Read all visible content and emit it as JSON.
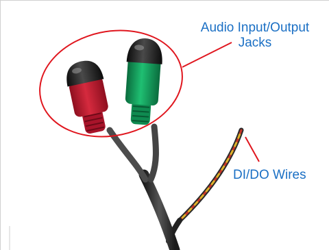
{
  "callouts": {
    "audio_line1": "Audio Input/Output",
    "audio_line2": "Jacks",
    "dido": "DI/DO Wires"
  },
  "colors": {
    "callout_text": "#1a6fc4",
    "callout_outline": "#e0161e",
    "red_jack": "#c0182c",
    "green_jack": "#14a060",
    "cable": "#333333",
    "frame_border": "#cccccc"
  }
}
